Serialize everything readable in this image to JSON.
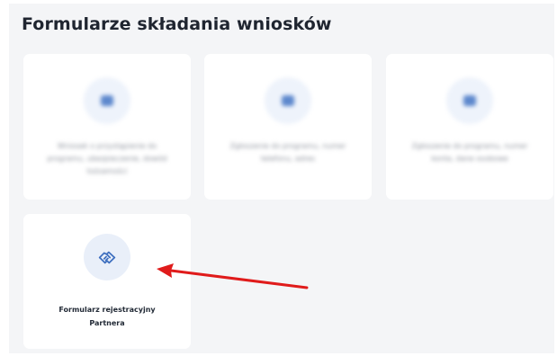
{
  "section": {
    "title": "Formularze składania wniosków"
  },
  "tiles": [
    {
      "label": "Wniosek o przystąpienie do programu, ubezpieczenie, dowód tożsamości",
      "icon": "document-icon",
      "blurred": true
    },
    {
      "label": "Zgłoszenie do programu, numer telefonu, adres",
      "icon": "document-icon",
      "blurred": true
    },
    {
      "label": "Zgłoszenie do programu, numer konta, dane osobowe",
      "icon": "document-icon",
      "blurred": true
    },
    {
      "label_line1": "Formularz rejestracyjny",
      "label_line2": "Partnera",
      "icon": "handshake-icon",
      "blurred": false
    }
  ],
  "annotation": {
    "arrow_color": "#e01b1b",
    "points_to": "handshake-icon"
  },
  "colors": {
    "panel_bg": "#f4f5f7",
    "tile_bg": "#ffffff",
    "icon_circle_bg": "#e9eff9",
    "icon_color": "#3e6fbf",
    "heading_color": "#1f2530"
  }
}
